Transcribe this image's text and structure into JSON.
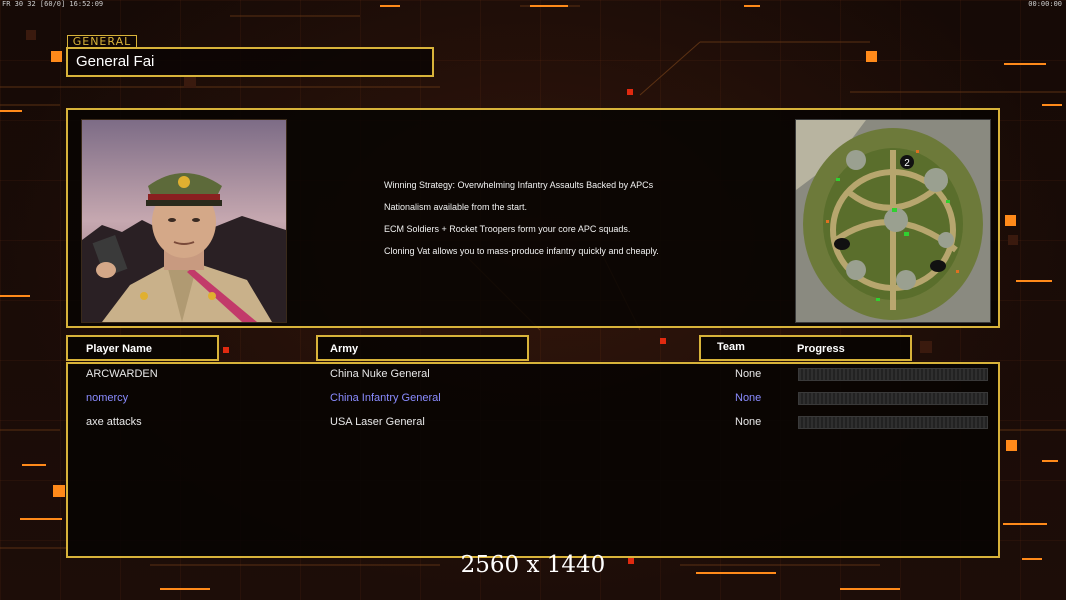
{
  "hud": {
    "top_left": "FR 30 32 [60/0] 16:52:09",
    "top_right": "00:00:00"
  },
  "general": {
    "section_label": "GENERAL",
    "name": "General Fai"
  },
  "strategy_lines": [
    "Winning Strategy: Overwhelming Infantry Assaults Backed by APCs",
    "Nationalism available from the start.",
    "ECM Soldiers + Rocket Troopers form your core APC squads.",
    "Cloning Vat allows you to mass-produce infantry quickly and cheaply."
  ],
  "minimap": {
    "marker_label": "2"
  },
  "columns": {
    "player_name": "Player Name",
    "army": "Army",
    "team": "Team",
    "progress": "Progress"
  },
  "players": [
    {
      "name": "ARCWARDEN",
      "army": "China Nuke General",
      "team": "None",
      "progress": 0,
      "color": "#ffffff"
    },
    {
      "name": "nomercy",
      "army": "China Infantry General",
      "team": "None",
      "progress": 0,
      "color": "#8a8cff"
    },
    {
      "name": "axe attacks",
      "army": "USA Laser General",
      "team": "None",
      "progress": 0,
      "color": "#ffffff"
    }
  ],
  "resolution_text": "2560 x 1440",
  "colors": {
    "accent": "#d8b33a",
    "orange": "#ff8a1a",
    "red": "#e02a10"
  }
}
